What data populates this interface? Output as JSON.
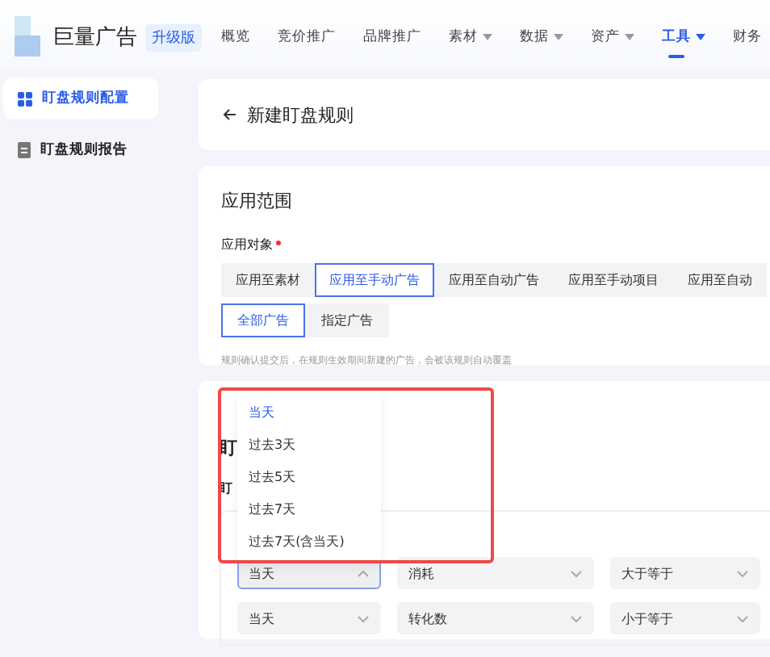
{
  "brand": {
    "name": "巨量广告",
    "badge": "升级版"
  },
  "nav": [
    {
      "label": "概览",
      "dropdown": false,
      "selected": false
    },
    {
      "label": "竞价推广",
      "dropdown": false,
      "selected": false
    },
    {
      "label": "品牌推广",
      "dropdown": false,
      "selected": false
    },
    {
      "label": "素材",
      "dropdown": true,
      "selected": false
    },
    {
      "label": "数据",
      "dropdown": true,
      "selected": false
    },
    {
      "label": "资产",
      "dropdown": true,
      "selected": false
    },
    {
      "label": "工具",
      "dropdown": true,
      "selected": true
    },
    {
      "label": "财务",
      "dropdown": false,
      "selected": false
    }
  ],
  "sidebar": {
    "items": [
      {
        "label": "盯盘规则配置",
        "kind": "grid",
        "selected": true
      },
      {
        "label": "盯盘规则报告",
        "kind": "doc",
        "selected": false
      }
    ]
  },
  "page_title": "新建盯盘规则",
  "scope": {
    "title": "应用范围",
    "field_label": "应用对象",
    "required": true,
    "tabs": [
      {
        "label": "应用至素材",
        "selected": false
      },
      {
        "label": "应用至手动广告",
        "selected": true
      },
      {
        "label": "应用至自动广告",
        "selected": false
      },
      {
        "label": "应用至手动项目",
        "selected": false
      },
      {
        "label": "应用至自动",
        "selected": false
      }
    ],
    "sub_tabs": [
      {
        "label": "全部广告",
        "selected": true
      },
      {
        "label": "指定广告",
        "selected": false
      }
    ],
    "hint": "规则确认提交后，在规则生效期间新建的广告，会被该规则自动覆盖"
  },
  "rules": {
    "title": "盯",
    "field_label": "盯",
    "conditions": [
      {
        "selects": [
          {
            "value": "当天",
            "open": true
          },
          {
            "value": "消耗",
            "open": false
          },
          {
            "value": "大于等于",
            "open": false
          }
        ]
      },
      {
        "selects": [
          {
            "value": "当天",
            "open": false
          },
          {
            "value": "转化数",
            "open": false
          },
          {
            "value": "小于等于",
            "open": false
          }
        ]
      }
    ]
  },
  "dropdown_menu": {
    "options": [
      {
        "label": "当天",
        "selected": true
      },
      {
        "label": "过去3天",
        "selected": false
      },
      {
        "label": "过去5天",
        "selected": false
      },
      {
        "label": "过去7天",
        "selected": false
      },
      {
        "label": "过去7天(含当天)",
        "selected": false
      }
    ]
  }
}
